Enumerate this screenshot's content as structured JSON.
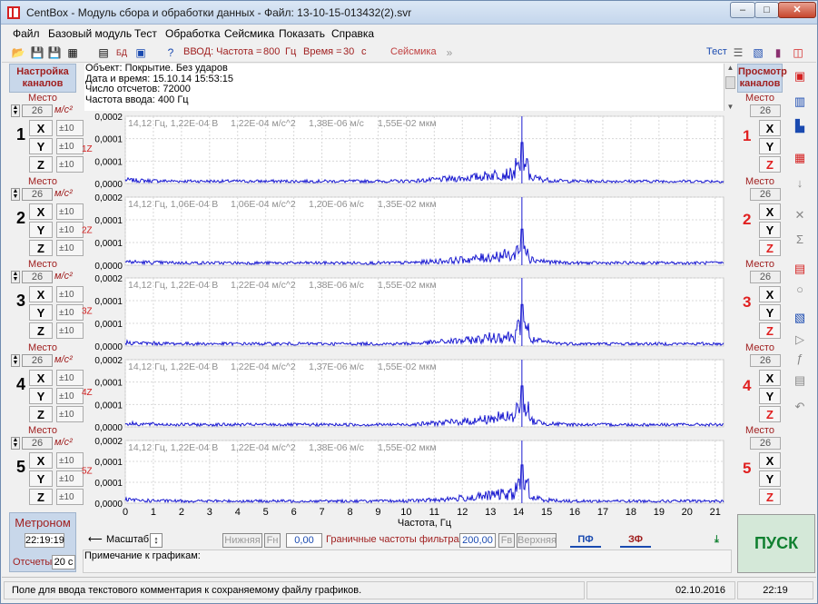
{
  "window": {
    "title": "CentBox - Модуль сбора и обработки данных - Файл: 13-10-15-013432(2).svr"
  },
  "menu": [
    "Файл",
    "Базовый модуль",
    "Тест",
    "Обработка",
    "Сейсмика",
    "Показать",
    "Справка"
  ],
  "toolbar": {
    "vvod_label": "ВВОД: Частота =",
    "freq": "800",
    "freq_unit": "Гц",
    "time_label": "Время =",
    "time": "30",
    "time_unit": "с",
    "seismic": "Сейсмика",
    "test": "Тест"
  },
  "left_panel": {
    "title1": "Настройка",
    "title2": "каналов",
    "place": "Место",
    "unit": "м/с²",
    "channels": [
      {
        "num": "1",
        "place": "26",
        "x": "±10",
        "y": "±10",
        "z": "±10"
      },
      {
        "num": "2",
        "place": "26",
        "x": "±10",
        "y": "±10",
        "z": "±10"
      },
      {
        "num": "3",
        "place": "26",
        "x": "±10",
        "y": "±10",
        "z": "±10"
      },
      {
        "num": "4",
        "place": "26",
        "x": "±10",
        "y": "±10",
        "z": "±10"
      },
      {
        "num": "5",
        "place": "26",
        "x": "±10",
        "y": "±10",
        "z": "±10"
      }
    ],
    "axis_x": "X",
    "axis_y": "Y",
    "axis_z": "Z"
  },
  "metronome": {
    "title": "Метроном",
    "time": "22:19:19",
    "counts_label": "Отсчеты",
    "counts": "20 с"
  },
  "info": {
    "line1": "Объект: Покрытие. Без ударов",
    "line2": "Дата и время: 15.10.14  15:53:15",
    "line3": "Число отсчетов: 72000",
    "line4": "Частота ввода: 400 Гц"
  },
  "chart_data": {
    "type": "line",
    "xlabel": "Частота, Гц",
    "x_ticks": [
      "0",
      "1",
      "2",
      "3",
      "4",
      "5",
      "6",
      "7",
      "8",
      "9",
      "10",
      "11",
      "12",
      "13",
      "14",
      "15",
      "16",
      "17",
      "18",
      "19",
      "20",
      "21"
    ],
    "y_ticks": [
      "0,0000",
      "0,0001",
      "0,0001",
      "0,0002"
    ],
    "xlim": [
      0,
      21.3
    ],
    "ylim": [
      0,
      0.0002
    ],
    "peak_x": 14.12,
    "series": [
      {
        "name": "1Z",
        "readout": [
          "14,12  Гц,  1,22E-04  В",
          "1,22E-04  м/с^2",
          "1,38E-06  м/с",
          "1,55E-02  мкм"
        ],
        "peak": 0.000122
      },
      {
        "name": "2Z",
        "readout": [
          "14,12  Гц,  1,06E-04  В",
          "1,06E-04  м/с^2",
          "1,20E-06  м/с",
          "1,35E-02  мкм"
        ],
        "peak": 0.000106
      },
      {
        "name": "3Z",
        "readout": [
          "14,12  Гц,  1,22E-04  В",
          "1,22E-04  м/с^2",
          "1,38E-06  м/с",
          "1,55E-02  мкм"
        ],
        "peak": 0.000122
      },
      {
        "name": "4Z",
        "readout": [
          "14,12  Гц,  1,22E-04  В",
          "1,22E-04  м/с^2",
          "1,37E-06  м/с",
          "1,55E-02  мкм"
        ],
        "peak": 0.000122
      },
      {
        "name": "5Z",
        "readout": [
          "14,12  Гц,  1,22E-04  В",
          "1,22E-04  м/с^2",
          "1,38E-06  м/с",
          "1,55E-02  мкм"
        ],
        "peak": 0.000122
      }
    ]
  },
  "bottom_bar": {
    "scale": "Масштаб",
    "lower": "Нижняя",
    "fn": "Fн",
    "lower_val": "0,00",
    "boundary": "Граничные частоты фильтра, Гц",
    "upper_val": "200,00",
    "fv": "Fв",
    "upper": "Верхняя",
    "pf": "ПФ",
    "zf": "ЗФ"
  },
  "note": {
    "label": "Примечание к графикам:"
  },
  "right_panel": {
    "title1": "Просмотр",
    "title2": "каналов",
    "place": "Место",
    "channels": [
      {
        "num": "1",
        "place": "26"
      },
      {
        "num": "2",
        "place": "26"
      },
      {
        "num": "3",
        "place": "26"
      },
      {
        "num": "4",
        "place": "26"
      },
      {
        "num": "5",
        "place": "26"
      }
    ]
  },
  "pusk": "ПУСК",
  "status": {
    "text": "Поле для ввода текстового комментария к сохраняемому файлу графиков.",
    "date": "02.10.2016",
    "time": "22:19"
  }
}
